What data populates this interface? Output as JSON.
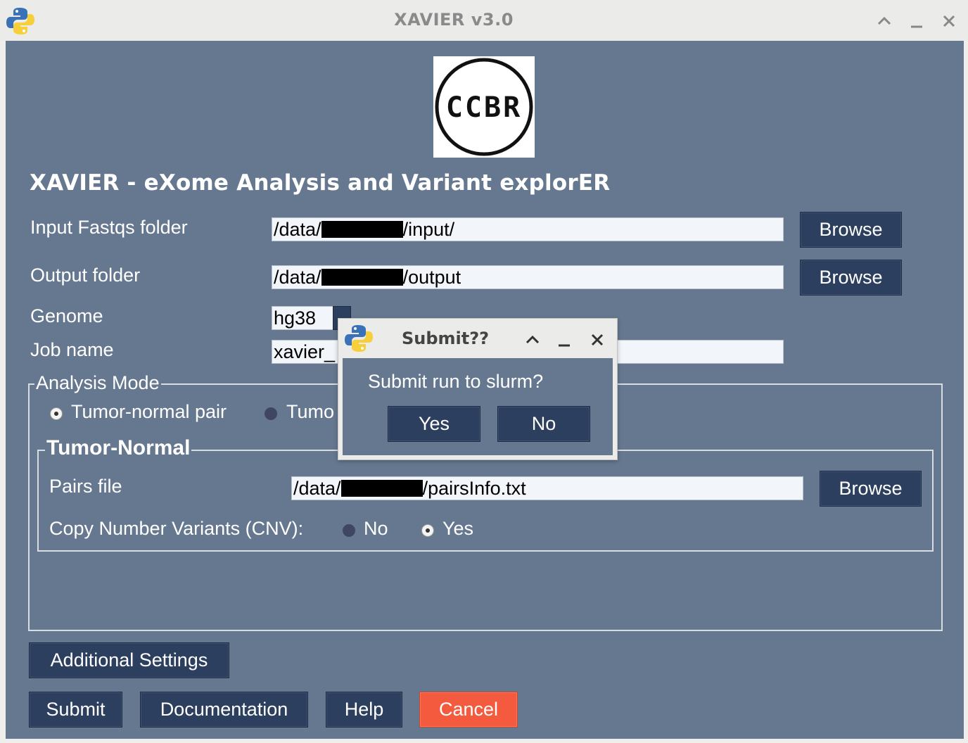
{
  "window": {
    "title": "XAVIER v3.0"
  },
  "logo": {
    "text": "CCBR"
  },
  "heading": "XAVIER - eXome Analysis and Variant explorER",
  "form": {
    "input_label": "Input Fastqs folder",
    "input_prefix": "/data/",
    "input_suffix": "/input/",
    "output_label": "Output folder",
    "output_prefix": "/data/",
    "output_suffix": "/output",
    "browse_label": "Browse",
    "genome_label": "Genome",
    "genome_value": "hg38",
    "jobname_label": "Job name",
    "jobname_value": "xavier_"
  },
  "analysis_mode": {
    "title": "Analysis Mode",
    "option_pair": "Tumor-normal pair",
    "option_only": "Tumo",
    "selected": "Tumor-normal pair"
  },
  "tumor_normal": {
    "title": "Tumor-Normal",
    "pairs_label": "Pairs file",
    "pairs_prefix": "/data/",
    "pairs_suffix": "/pairsInfo.txt",
    "browse_label": "Browse",
    "cnv_label": "Copy Number Variants (CNV):",
    "cnv_no": "No",
    "cnv_yes": "Yes",
    "cnv_selected": "Yes"
  },
  "buttons": {
    "additional_settings": "Additional Settings",
    "submit": "Submit",
    "documentation": "Documentation",
    "help": "Help",
    "cancel": "Cancel"
  },
  "dialog": {
    "title": "Submit??",
    "message": "Submit run to slurm?",
    "yes": "Yes",
    "no": "No"
  },
  "icons": {
    "app": "python-logo-icon",
    "maximize": "chevron-up-icon",
    "minimize": "minimize-icon",
    "close": "close-icon"
  },
  "colors": {
    "background": "#66788f",
    "button": "#2d3f5e",
    "cancel": "#f35a3e"
  }
}
